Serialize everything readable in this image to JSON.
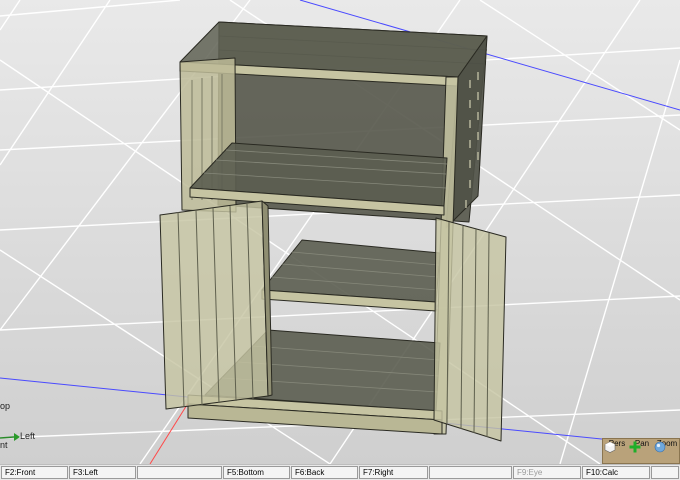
{
  "axes": {
    "top_label": "op",
    "front_label": "nt",
    "left_label": "Left"
  },
  "view_controls": [
    {
      "label": "Pers",
      "icon": "perspective-cube-icon"
    },
    {
      "label": "Pan",
      "icon": "pan-cross-icon"
    },
    {
      "label": "Zoom",
      "icon": "zoom-sphere-icon"
    }
  ],
  "function_keys": [
    {
      "label": "F2:Front",
      "enabled": true
    },
    {
      "label": "F3:Left",
      "enabled": true
    },
    {
      "label": "",
      "enabled": true
    },
    {
      "label": "F5:Bottom",
      "enabled": true
    },
    {
      "label": "F6:Back",
      "enabled": true
    },
    {
      "label": "F7:Right",
      "enabled": true
    },
    {
      "label": "",
      "enabled": true
    },
    {
      "label": "F9:Eye",
      "enabled": false
    },
    {
      "label": "F10:Calc",
      "enabled": true
    },
    {
      "label": "",
      "enabled": true
    }
  ],
  "colors": {
    "panel_face": "#c6c4a2",
    "panel_dark": "#55574a",
    "edge": "#2a2a22",
    "grid": "#ffffff",
    "x_axis": "#4a4aff",
    "y_axis": "#ff4a4a"
  }
}
